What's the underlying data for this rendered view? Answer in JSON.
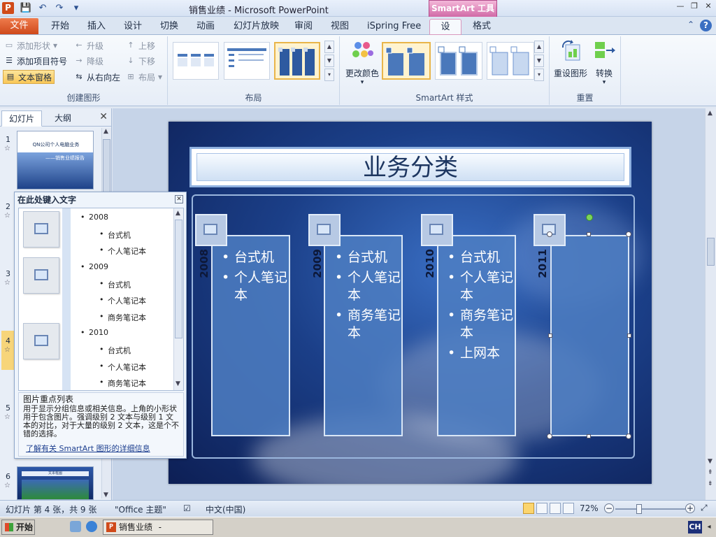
{
  "window": {
    "title": "销售业绩 - Microsoft PowerPoint",
    "tool_tab": "SmartArt 工具"
  },
  "tabs": [
    "文件",
    "开始",
    "插入",
    "设计",
    "切换",
    "动画",
    "幻灯片放映",
    "审阅",
    "视图",
    "iSpring Free",
    "设计",
    "格式"
  ],
  "ribbon": {
    "create_graphic": {
      "label": "创建图形",
      "add_shape": "添加形状",
      "add_bullet": "添加项目符号",
      "text_pane": "文本窗格",
      "promote": "升级",
      "demote": "降级",
      "right_to_left": "从右向左",
      "move_up": "上移",
      "move_down": "下移",
      "layout": "布局"
    },
    "layout_group": {
      "label": "布局"
    },
    "styles_group": {
      "label": "SmartArt 样式",
      "change_colors": "更改颜色"
    },
    "reset_group": {
      "label": "重置",
      "reset_graphic": "重设图形",
      "convert": "转换"
    }
  },
  "slide_panel": {
    "tabs": [
      "幻灯片",
      "大纲"
    ],
    "slide_numbers": [
      "1",
      "2",
      "3",
      "4",
      "5",
      "6"
    ],
    "thumb1_title": "QN公司个人电脑业务",
    "thumb1_subtitle": "——销售业绩报告",
    "thumb6_title": "文本框图"
  },
  "slide": {
    "title": "业务分类",
    "columns": [
      {
        "year": "2008",
        "items": [
          "台式机",
          "个人笔记本"
        ]
      },
      {
        "year": "2009",
        "items": [
          "台式机",
          "个人笔记本",
          "商务笔记本"
        ]
      },
      {
        "year": "2010",
        "items": [
          "台式机",
          "个人笔记本",
          "商务笔记本",
          "上网本"
        ]
      },
      {
        "year": "2011",
        "items": []
      }
    ]
  },
  "text_pane": {
    "header": "在此处键入文字",
    "lines": [
      {
        "level": 1,
        "text": "2008"
      },
      {
        "level": 2,
        "text": "台式机"
      },
      {
        "level": 2,
        "text": "个人笔记本"
      },
      {
        "level": 1,
        "text": "2009"
      },
      {
        "level": 2,
        "text": "台式机"
      },
      {
        "level": 2,
        "text": "个人笔记本"
      },
      {
        "level": 2,
        "text": "商务笔记本"
      },
      {
        "level": 1,
        "text": "2010"
      },
      {
        "level": 2,
        "text": "台式机"
      },
      {
        "level": 2,
        "text": "个人笔记本"
      },
      {
        "level": 2,
        "text": "商务笔记本"
      }
    ],
    "desc_title": "图片重点列表",
    "desc_body": "用于显示分组信息或相关信息。上角的小形状用于包含图片。强调级别 2 文本与级别 1 文本的对比，对于大量的级别 2 文本，这是个不错的选择。",
    "desc_link": "了解有关 SmartArt 图形的详细信息"
  },
  "statusbar": {
    "slide_info": "幻灯片 第 4 张，共 9 张",
    "theme": "\"Office 主题\"",
    "language": "中文(中国)",
    "zoom": "72%"
  },
  "taskbar": {
    "start": "开始",
    "task": "销售业绩 - Microsof...",
    "ime": "CH"
  }
}
